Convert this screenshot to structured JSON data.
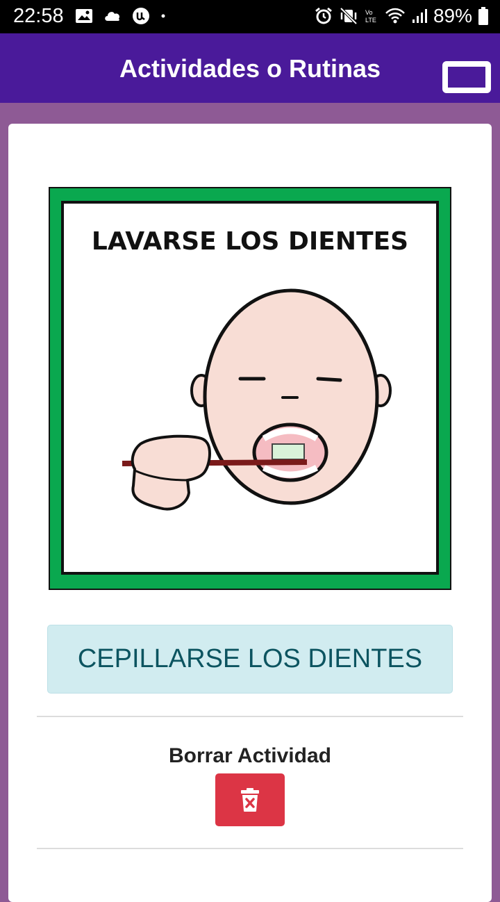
{
  "status_bar": {
    "time": "22:58",
    "battery": "89%",
    "icons": [
      "image-icon",
      "cloud-icon",
      "u-app-icon",
      "dot-icon",
      "alarm-icon",
      "vibrate-mute-icon",
      "volte-icon",
      "wifi-icon",
      "signal-icon",
      "battery-icon"
    ]
  },
  "app_bar": {
    "title": "Actividades o Rutinas",
    "color": "#4a1a9a"
  },
  "pictogram": {
    "caption": "LAVARSE LOS DIENTES",
    "border_color": "#0aa84f"
  },
  "activity": {
    "label": "CEPILLARSE LOS DIENTES"
  },
  "delete": {
    "label": "Borrar Actividad",
    "button_color": "#dc3545",
    "icon": "trash-icon"
  }
}
